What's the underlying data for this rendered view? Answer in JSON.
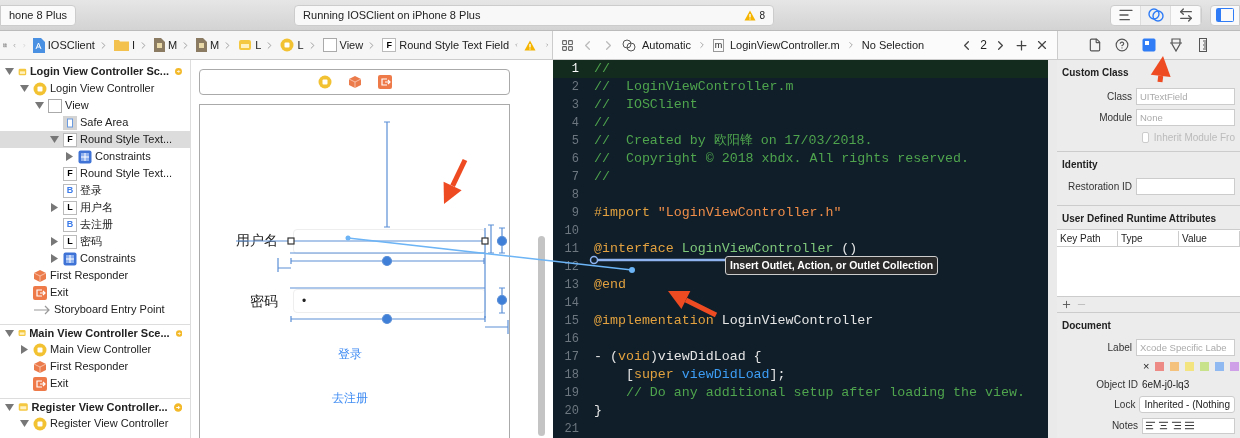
{
  "toolbar": {
    "scheme": "hone 8 Plus",
    "activity": "Running IOSClient on iPhone 8 Plus",
    "warnings": "8",
    "editor_modes": [
      {
        "kind": "standard",
        "selected": false
      },
      {
        "kind": "assistant",
        "selected": true
      },
      {
        "kind": "version",
        "selected": false
      }
    ],
    "navigator_panel": {
      "on": true
    }
  },
  "left_jump_bar": {
    "items": [
      {
        "kind": "project",
        "label": "IOSClient"
      },
      {
        "kind": "folder",
        "label": "I"
      },
      {
        "kind": "file",
        "label": "M"
      },
      {
        "kind": "file",
        "label": "M"
      },
      {
        "kind": "scene",
        "label": "L"
      },
      {
        "kind": "controller",
        "label": "L"
      },
      {
        "kind": "view",
        "label": "View"
      },
      {
        "kind": "field",
        "label": "Round Style Text Field",
        "badge": "F"
      }
    ]
  },
  "right_jump_bar": {
    "mode": "Automatic",
    "file_badge": "m",
    "file": "LoginViewController.m",
    "selection": "No Selection",
    "counterpart": "2"
  },
  "inspector_tabs": [
    {
      "kind": "file",
      "selected": false
    },
    {
      "kind": "help",
      "selected": false
    },
    {
      "kind": "identity",
      "selected": true
    },
    {
      "kind": "attributes",
      "selected": false
    },
    {
      "kind": "size",
      "selected": false
    }
  ],
  "outline": [
    {
      "kind": "scene",
      "label": "Login View Controller Sc...",
      "expanded": true,
      "selected": false,
      "children": [
        {
          "kind": "controller",
          "label": "Login View Controller",
          "expanded": true,
          "selected": false,
          "children": [
            {
              "kind": "view",
              "label": "View",
              "expanded": true,
              "selected": false,
              "children": [
                {
                  "kind": "safe_area",
                  "label": "Safe Area",
                  "selected": false
                },
                {
                  "kind": "field",
                  "badge": "F",
                  "label": "Round Style Text...",
                  "expanded": true,
                  "selected": true,
                  "children": [
                    {
                      "kind": "constraints",
                      "label": "Constraints",
                      "expanded": false,
                      "selected": false
                    }
                  ]
                },
                {
                  "kind": "field",
                  "badge": "F",
                  "label": "Round Style Text...",
                  "selected": false
                },
                {
                  "kind": "button",
                  "badge": "B",
                  "label": "登录",
                  "selected": false
                },
                {
                  "kind": "label",
                  "badge": "L",
                  "label": "用户名",
                  "expanded": false,
                  "selected": false
                },
                {
                  "kind": "button",
                  "badge": "B",
                  "label": "去注册",
                  "selected": false
                },
                {
                  "kind": "label",
                  "badge": "L",
                  "label": "密码",
                  "expanded": false,
                  "selected": false
                },
                {
                  "kind": "constraints",
                  "label": "Constraints",
                  "expanded": false,
                  "selected": false
                }
              ]
            }
          ]
        },
        {
          "kind": "responder",
          "label": "First Responder",
          "selected": false
        },
        {
          "kind": "exit",
          "label": "Exit",
          "selected": false
        },
        {
          "kind": "entry",
          "label": "Storyboard Entry Point",
          "selected": false
        }
      ]
    },
    {
      "kind": "scene",
      "label": "Main View Controller Sce...",
      "expanded": true,
      "selected": false,
      "children": [
        {
          "kind": "controller",
          "label": "Main View Controller",
          "expanded": false,
          "selected": false
        },
        {
          "kind": "responder",
          "label": "First Responder",
          "selected": false
        },
        {
          "kind": "exit",
          "label": "Exit",
          "selected": false
        }
      ]
    },
    {
      "kind": "scene",
      "label": "Register View Controller...",
      "expanded": true,
      "selected": false,
      "children": [
        {
          "kind": "controller",
          "label": "Register View Controller",
          "expanded": true,
          "selected": false
        }
      ]
    }
  ],
  "canvas": {
    "dock": [
      {
        "kind": "controller"
      },
      {
        "kind": "responder"
      },
      {
        "kind": "exit"
      }
    ],
    "username_label": "用户名",
    "password_label": "密码",
    "password_value": "•",
    "login_button": "登录",
    "register_button": "去注册"
  },
  "editor": {
    "tooltip": "Insert Outlet, Action, or Outlet Collection",
    "lines": [
      {
        "number": "1",
        "current": true,
        "tokens": [
          {
            "kind": "comment",
            "text": "//"
          }
        ]
      },
      {
        "number": "2",
        "current": false,
        "tokens": [
          {
            "kind": "comment",
            "text": "//  LoginViewController.m"
          }
        ]
      },
      {
        "number": "3",
        "current": false,
        "tokens": [
          {
            "kind": "comment",
            "text": "//  IOSClient"
          }
        ]
      },
      {
        "number": "4",
        "current": false,
        "tokens": [
          {
            "kind": "comment",
            "text": "//"
          }
        ]
      },
      {
        "number": "5",
        "current": false,
        "tokens": [
          {
            "kind": "comment",
            "text": "//  Created by 欧阳锋 on 17/03/2018."
          }
        ]
      },
      {
        "number": "6",
        "current": false,
        "tokens": [
          {
            "kind": "comment",
            "text": "//  Copyright © 2018 xbdx. All rights reserved."
          }
        ]
      },
      {
        "number": "7",
        "current": false,
        "tokens": [
          {
            "kind": "comment",
            "text": "//"
          }
        ]
      },
      {
        "number": "8",
        "current": false
      },
      {
        "number": "9",
        "current": false,
        "tokens": [
          {
            "kind": "preprocessor",
            "text": "#import "
          },
          {
            "kind": "string",
            "text": "\"LoginViewController.h\""
          }
        ]
      },
      {
        "number": "10",
        "current": false
      },
      {
        "number": "11",
        "current": false,
        "tokens": [
          {
            "kind": "keyword",
            "text": "@interface "
          },
          {
            "kind": "class",
            "text": "LoginViewController"
          },
          {
            "kind": "plain",
            "text": " ()"
          }
        ]
      },
      {
        "number": "12",
        "current": false
      },
      {
        "number": "13",
        "current": false,
        "tokens": [
          {
            "kind": "keyword",
            "text": "@end"
          }
        ]
      },
      {
        "number": "14",
        "current": false
      },
      {
        "number": "15",
        "current": false,
        "tokens": [
          {
            "kind": "keyword",
            "text": "@implementation "
          },
          {
            "kind": "plain",
            "text": "LoginViewController"
          }
        ]
      },
      {
        "number": "16",
        "current": false
      },
      {
        "number": "17",
        "current": false,
        "tokens": [
          {
            "kind": "plain",
            "text": "- ("
          },
          {
            "kind": "keyword",
            "text": "void"
          },
          {
            "kind": "plain",
            "text": ")viewDidLoad {"
          }
        ]
      },
      {
        "number": "18",
        "current": false,
        "tokens": [
          {
            "kind": "plain",
            "text": "    ["
          },
          {
            "kind": "keyword",
            "text": "super "
          },
          {
            "kind": "method",
            "text": "viewDidLoad"
          },
          {
            "kind": "plain",
            "text": "];"
          }
        ]
      },
      {
        "number": "19",
        "current": false,
        "tokens": [
          {
            "kind": "comment",
            "text": "    // Do any additional setup after loading the view."
          }
        ]
      },
      {
        "number": "20",
        "current": false,
        "tokens": [
          {
            "kind": "plain",
            "text": "}"
          }
        ]
      },
      {
        "number": "21",
        "current": false
      }
    ]
  },
  "inspector": {
    "custom_class": {
      "title": "Custom Class",
      "fields": [
        {
          "label": "Class",
          "placeholder": "UITextField"
        },
        {
          "label": "Module",
          "placeholder": "None"
        }
      ],
      "inherit": {
        "label": "Inherit Module Fro",
        "checked": false,
        "disabled": true
      }
    },
    "identity": {
      "title": "Identity",
      "fields": [
        {
          "label": "Restoration ID"
        }
      ]
    },
    "runtime_attributes": {
      "title": "User Defined Runtime Attributes",
      "columns": [
        "Key Path",
        "Type",
        "Value"
      ]
    },
    "document": {
      "title": "Document",
      "label_field": {
        "label": "Label",
        "placeholder": "Xcode Specific Labe"
      },
      "clear": "×",
      "swatches": [
        {
          "color": "#ee8a86"
        },
        {
          "color": "#f4c27c"
        },
        {
          "color": "#f3e480"
        },
        {
          "color": "#c8e28c"
        },
        {
          "color": "#8fb9f0"
        },
        {
          "color": "#cfa0e8"
        }
      ],
      "object_id": {
        "label": "Object ID",
        "value": "6eM-j0-lq3"
      },
      "lock": {
        "label": "Lock",
        "value": "Inherited - (Nothing"
      },
      "notes": {
        "label": "Notes"
      }
    }
  }
}
